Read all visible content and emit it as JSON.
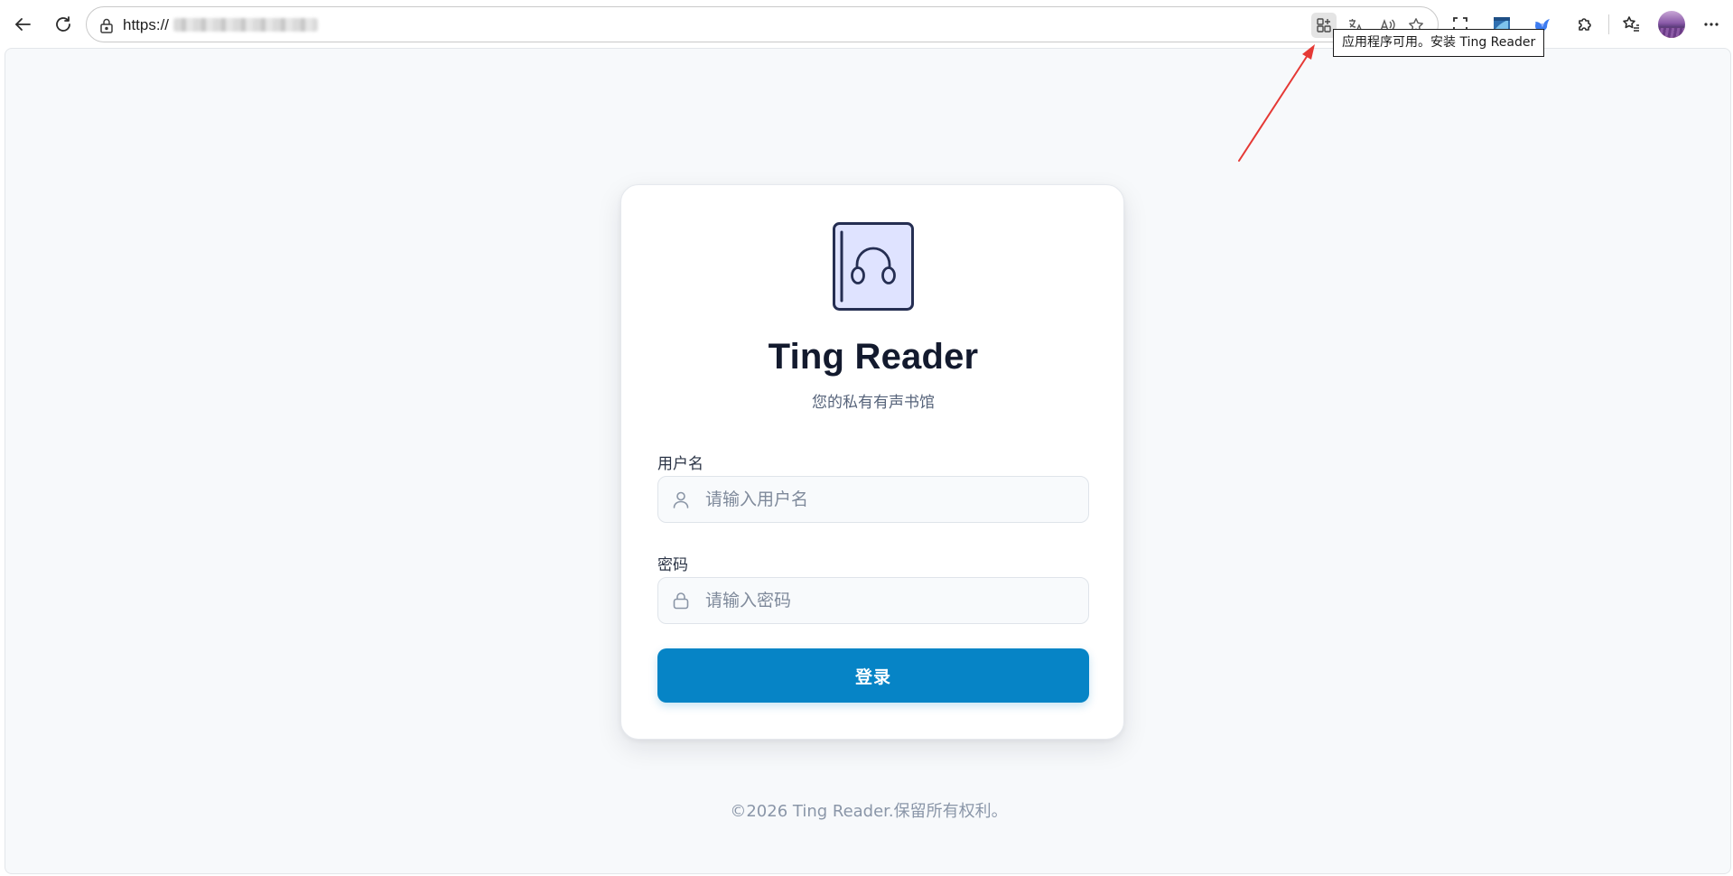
{
  "browser": {
    "url_prefix": "https://",
    "tooltip": "应用程序可用。安装 Ting Reader",
    "icons": [
      "back-arrow-icon",
      "refresh-icon",
      "lock-icon",
      "app-install-icon",
      "translate-icon",
      "read-aloud-icon",
      "favorite-star-icon",
      "screenshot-icon",
      "browser-ext-icon",
      "bird-ext-icon",
      "extensions-puzzle-icon",
      "favorites-list-icon",
      "more-dots-icon"
    ]
  },
  "login": {
    "app_title": "Ting Reader",
    "subtitle": "您的私有有声书馆",
    "username_label": "用户名",
    "username_placeholder": "请输入用户名",
    "password_label": "密码",
    "password_placeholder": "请输入密码",
    "submit_label": "登录"
  },
  "footer": {
    "copyright": "©2026 Ting Reader.保留所有权利。"
  },
  "colors": {
    "primary": "#0684c6",
    "title": "#131a2e",
    "logo_bg": "#dfe3ff",
    "logo_stroke": "#252e52",
    "annotation_arrow": "#e53935"
  }
}
